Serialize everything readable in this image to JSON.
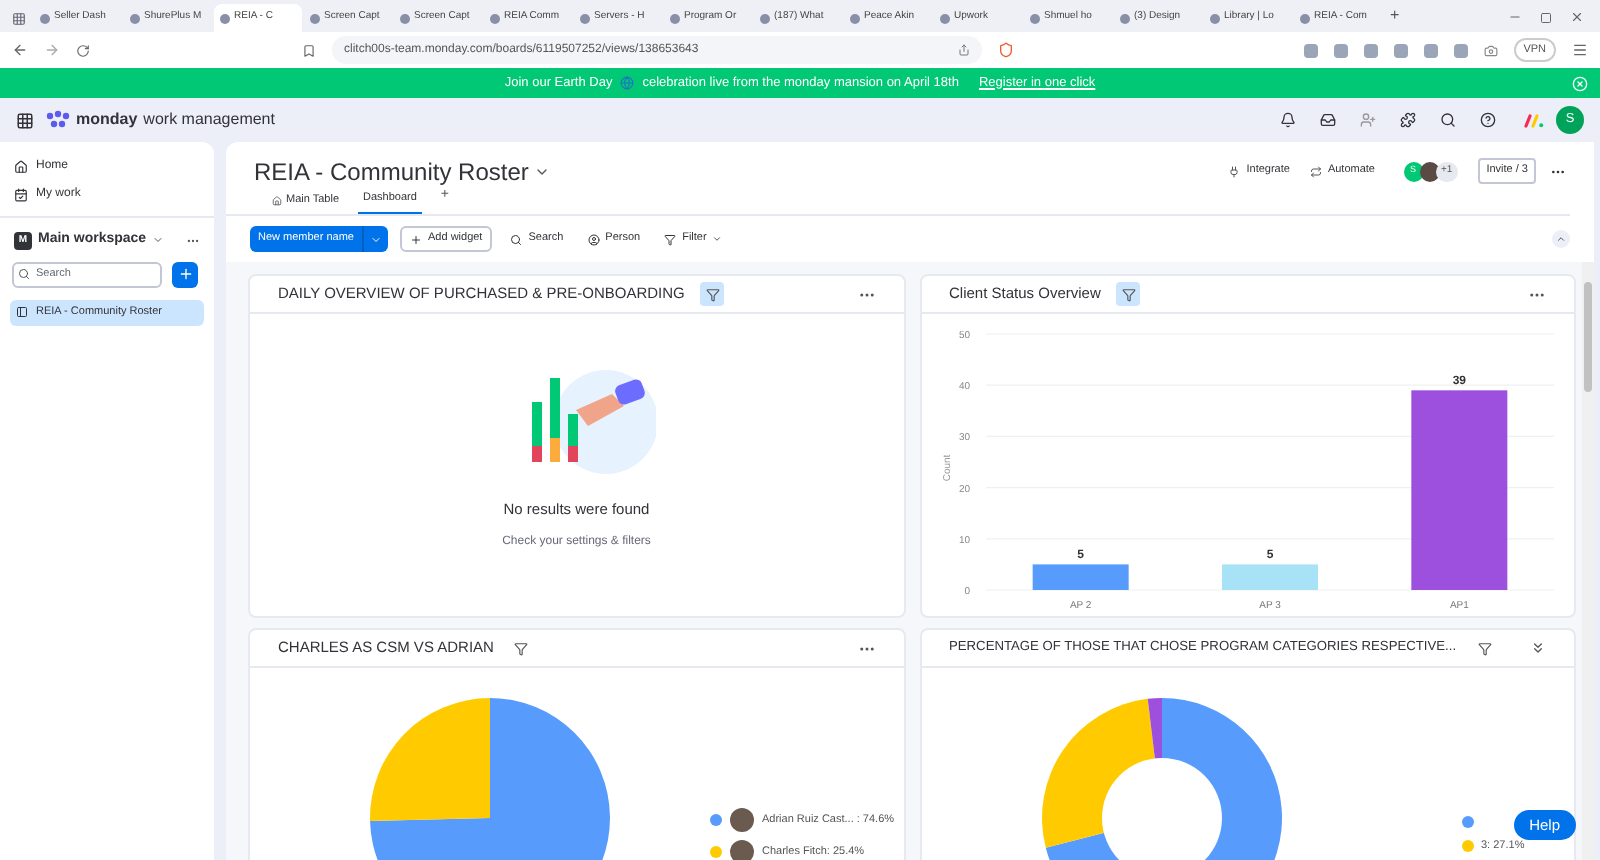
{
  "browser": {
    "tabs": [
      {
        "label": "Seller Dash",
        "selected": false
      },
      {
        "label": "ShurePlus M",
        "selected": false
      },
      {
        "label": "REIA - C",
        "selected": true
      },
      {
        "label": "Screen Capt",
        "selected": false
      },
      {
        "label": "Screen Capt",
        "selected": false
      },
      {
        "label": "REIA Comm",
        "selected": false
      },
      {
        "label": "Servers - H",
        "selected": false
      },
      {
        "label": "Program Or",
        "selected": false
      },
      {
        "label": "(187) What",
        "selected": false
      },
      {
        "label": "Peace Akin",
        "selected": false
      },
      {
        "label": "Upwork",
        "selected": false
      },
      {
        "label": "Shmuel ho",
        "selected": false
      },
      {
        "label": "(3) Design",
        "selected": false
      },
      {
        "label": "Library | Lo",
        "selected": false
      },
      {
        "label": "REIA - Com",
        "selected": false
      }
    ],
    "new_tab": "+",
    "url": "clitch00s-team.monday.com/boards/6119507252/views/138653643",
    "vpn": "VPN"
  },
  "banner": {
    "text_before": "Join our Earth Day",
    "text_after": "celebration live from the monday mansion on April 18th",
    "link": "Register in one click"
  },
  "app_header": {
    "brand": "monday",
    "product": "work management",
    "avatar_initial": "S"
  },
  "sidebar": {
    "nav": [
      {
        "label": "Home",
        "kind": "home"
      },
      {
        "label": "My work",
        "kind": "calendar"
      }
    ],
    "workspace": {
      "name": "Main workspace",
      "initial": "M"
    },
    "search_placeholder": "Search",
    "boards": [
      {
        "label": "REIA - Community Roster",
        "selected": true
      }
    ]
  },
  "board": {
    "title": "REIA - Community Roster",
    "views": [
      {
        "label": "Main Table",
        "selected": false
      },
      {
        "label": "Dashboard",
        "selected": true
      }
    ],
    "add_view": "+",
    "integrate": "Integrate",
    "automate": "Automate",
    "member_initial": "S",
    "members_extra": "+1",
    "invite": "Invite / 3"
  },
  "toolbar": {
    "primary": "New member name",
    "add_widget": "Add widget",
    "search": "Search",
    "person": "Person",
    "filter": "Filter"
  },
  "widgets": [
    {
      "kind": "empty",
      "title": "DAILY OVERVIEW OF PURCHASED & PRE-ONBOARDING",
      "filter_active": true,
      "message": "No results were found",
      "hint": "Check your settings & filters"
    },
    {
      "kind": "chart",
      "title": "Client Status Overview",
      "filter_active": true,
      "bar_styles": [
        {
          "color": "#579bfc"
        },
        {
          "color": "#a8e2f6"
        },
        {
          "color": "#9d50dd"
        }
      ],
      "chart_data": {
        "type": "bar",
        "ylabel": "Count",
        "categories": [
          "AP 2",
          "AP 3",
          "AP1"
        ],
        "values": [
          5,
          5,
          39
        ],
        "ylim": [
          0,
          50
        ],
        "yticks": [
          0,
          10,
          20,
          30,
          40,
          50
        ],
        "grid": true,
        "data_labels": true
      }
    },
    {
      "kind": "chart",
      "title": "CHARLES AS CSM VS ADRIAN",
      "filter_active": false,
      "legend": [
        {
          "color": "#579bfc"
        },
        {
          "color": "#ffcb00"
        }
      ],
      "chart_data": {
        "type": "pie",
        "categories": [
          "Adrian Ruiz Cast... : 74.6%",
          "Charles Fitch: 25.4%"
        ],
        "values": [
          74.6,
          25.4
        ]
      }
    },
    {
      "kind": "donut",
      "title": "PERCENTAGE OF THOSE THAT CHOSE PROGRAM CATEGORIES RESPECTIVE...",
      "filter_active": false,
      "legend": [
        {
          "color": "#579bfc"
        },
        {
          "label": "3: 27.1%",
          "color": "#ffcb00"
        }
      ]
    }
  ],
  "help": "Help"
}
